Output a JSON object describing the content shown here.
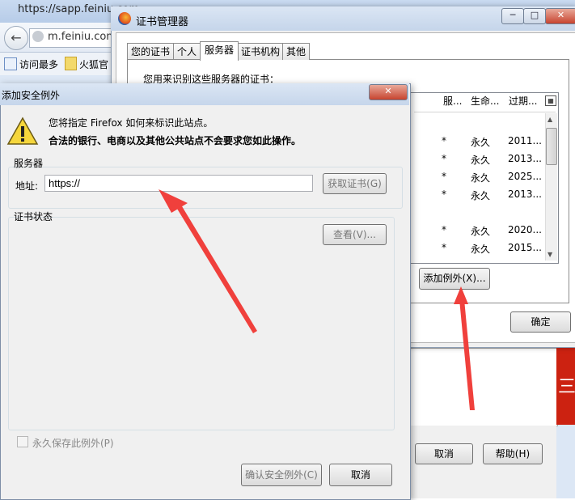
{
  "browser": {
    "tab_url": "https://sapp.feiniu.com",
    "url_host": "m.feiniu.com",
    "bookmarks": [
      "访问最多",
      "火狐官"
    ],
    "bg_cancel": "取消",
    "bg_help": "帮助(H)",
    "banner_glyph": "三"
  },
  "cert_manager": {
    "title": "证书管理器",
    "tabs": [
      "您的证书",
      "个人",
      "服务器",
      "证书机构",
      "其他"
    ],
    "active_tab": "服务器",
    "description": "您用来识别这些服务器的证书：",
    "columns": [
      "服...",
      "生命...",
      "过期..."
    ],
    "rows": [
      {
        "flag": "*",
        "life": "永久",
        "expires": "2011..."
      },
      {
        "flag": "*",
        "life": "永久",
        "expires": "2013..."
      },
      {
        "flag": "*",
        "life": "永久",
        "expires": "2025..."
      },
      {
        "flag": "*",
        "life": "永久",
        "expires": "2013..."
      },
      {
        "flag": "*",
        "life": "永久",
        "expires": "2020..."
      },
      {
        "flag": "*",
        "life": "永久",
        "expires": "2015..."
      }
    ],
    "add_exception": "添加例外(X)...",
    "ok": "确定"
  },
  "dialog": {
    "title": "添加安全例外",
    "warn_line1": "您将指定 Firefox 如何来标识此站点。",
    "warn_line2": "合法的银行、电商以及其他公共站点不会要求您如此操作。",
    "server_legend": "服务器",
    "address_label": "地址:",
    "address_value": "https://",
    "get_cert": "获取证书(G)",
    "status_legend": "证书状态",
    "view": "查看(V)...",
    "permanent": "永久保存此例外(P)",
    "confirm": "确认安全例外(C)",
    "cancel": "取消"
  },
  "colors": {
    "annotation_arrow": "#f0403c"
  }
}
